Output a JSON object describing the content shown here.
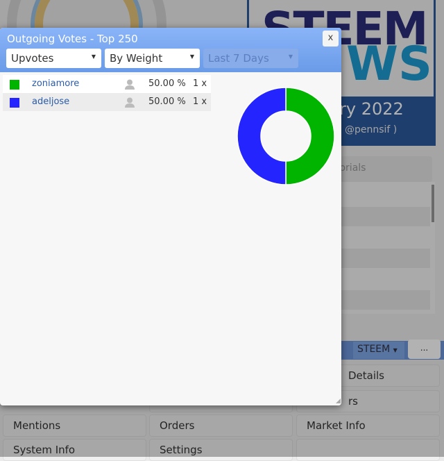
{
  "background": {
    "banner": {
      "line1": "STEEM",
      "line2": "WS",
      "date": "ry 2022",
      "byline": "@pennsif )"
    },
    "tab_label": "torials",
    "currency_select": "STEEM",
    "more_button": "...",
    "grid_buttons": [
      "Details",
      "rs",
      "Mentions",
      "Orders",
      "Market Info",
      "System Info",
      "Settings"
    ]
  },
  "dialog": {
    "title": "Outgoing Votes - Top 250",
    "close_label": "x",
    "filters": {
      "type": "Upvotes",
      "sort": "By Weight",
      "period": "Last 7 Days"
    },
    "rows": [
      {
        "name": "zoniamore",
        "percent": "50.00 %",
        "count": "1 x",
        "color": "#00b400"
      },
      {
        "name": "adeljose",
        "percent": "50.00 %",
        "count": "1 x",
        "color": "#2424ff"
      }
    ]
  },
  "chart_data": {
    "type": "pie",
    "donut": true,
    "categories": [
      "zoniamore",
      "adeljose"
    ],
    "values": [
      50,
      50
    ],
    "colors": [
      "#00b400",
      "#2424ff"
    ]
  }
}
